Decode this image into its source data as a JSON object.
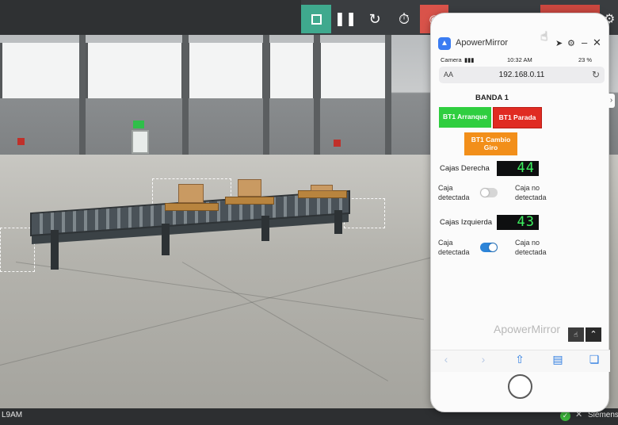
{
  "toolbar": {
    "stop_icon": "stop-square-icon",
    "pause_icon": "pause-icon",
    "reset_icon": "reset-icon",
    "timer_icon": "timer-icon",
    "record_icon": "record-eye-icon",
    "settings_icon": "gear-icon",
    "stop_color": "#3fa98e",
    "record_color": "#d9534a"
  },
  "status_bar": {
    "time_fragment": "L9AM",
    "vendor": "Siemens"
  },
  "mirror": {
    "app_title": "ApowerMirror",
    "watermark": "ApowerMirror",
    "ios_status": {
      "carrier": "Camera",
      "time": "10:32 AM",
      "battery": "23 %"
    },
    "url_bar": {
      "aa": "AA",
      "url": "192.168.0.11"
    },
    "page": {
      "title": "BANDA 1",
      "btn_start": "BT1 Arranque",
      "btn_stop": "BT1 Parada",
      "btn_change": "BT1 Cambio Giro",
      "right_label": "Cajas Derecha",
      "right_count": "44",
      "left_label": "Cajas Izquierda",
      "left_count": "43",
      "detected_label": "Caja detectada",
      "not_detected_label": "Caja no detectada",
      "right_toggle_on": false,
      "left_toggle_on": true
    }
  }
}
